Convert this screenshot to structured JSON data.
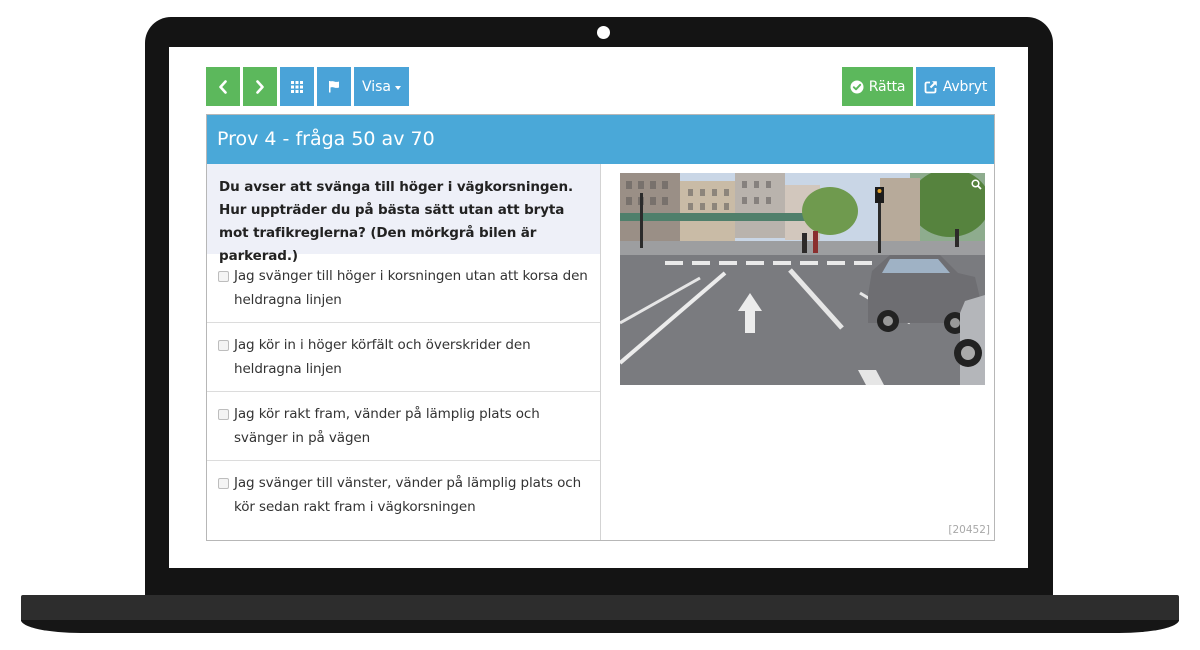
{
  "toolbar": {
    "prev_icon": "chevron-left-icon",
    "next_icon": "chevron-right-icon",
    "grid_icon": "grid-icon",
    "flag_icon": "flag-icon",
    "view_label": "Visa",
    "check_label": "Rätta",
    "abort_label": "Avbryt"
  },
  "colors": {
    "green": "#5cb85c",
    "blue": "#4aa3d8",
    "header": "#4aa8d8",
    "question_bg": "#eef0f8"
  },
  "exam": {
    "title": "Prov 4 - fråga 50 av 70",
    "question": "Du avser att svänga till höger i vägkorsningen. Hur uppträder du på bästa sätt utan att bryta mot trafikreglerna? (Den mörkgrå bilen är parkerad.)",
    "answers": [
      {
        "text": "Jag svänger till höger i korsningen utan att korsa den heldragna linjen",
        "checked": false
      },
      {
        "text": "Jag kör in i höger körfält och överskrider den heldragna linjen",
        "checked": false
      },
      {
        "text": "Jag kör rakt fram, vänder på lämplig plats och svänger in på vägen",
        "checked": false
      },
      {
        "text": "Jag svänger till vänster, vänder på lämplig plats och kör sedan rakt fram i vägkorsningen",
        "checked": false
      }
    ],
    "question_id": "[20452]"
  }
}
